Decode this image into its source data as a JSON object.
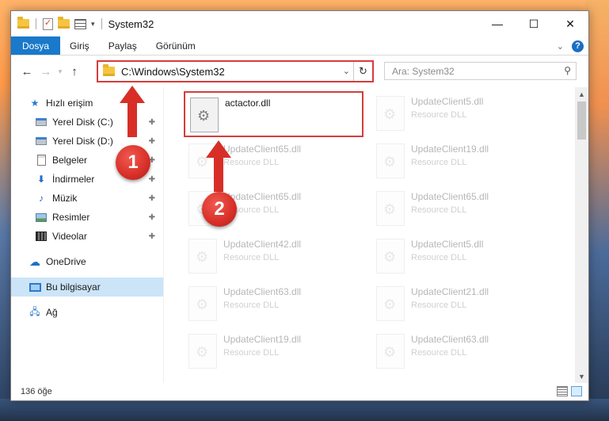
{
  "window": {
    "title": "System32",
    "qat_dropdown": "▾",
    "controls": {
      "minimize": "—",
      "maximize": "☐",
      "close": "✕"
    }
  },
  "ribbon": {
    "tabs": [
      "Dosya",
      "Giriş",
      "Paylaş",
      "Görünüm"
    ],
    "expand_chevron": "⌄",
    "help": "?"
  },
  "nav": {
    "back": "←",
    "forward": "→",
    "up": "↑",
    "address": "C:\\Windows\\System32",
    "address_dropdown": "⌄",
    "refresh": "↻",
    "search_placeholder": "Ara: System32",
    "search_icon": "⚲"
  },
  "sidebar": {
    "quick_access": "Hızlı erişim",
    "items": [
      {
        "label": "Yerel Disk (C:)",
        "icon": "disk-icon"
      },
      {
        "label": "Yerel Disk (D:)",
        "icon": "disk-icon"
      },
      {
        "label": "Belgeler",
        "icon": "document-icon"
      },
      {
        "label": "İndirmeler",
        "icon": "download-icon"
      },
      {
        "label": "Müzik",
        "icon": "music-icon"
      },
      {
        "label": "Resimler",
        "icon": "pictures-icon"
      },
      {
        "label": "Videolar",
        "icon": "video-icon"
      }
    ],
    "pin_glyph": "📌",
    "onedrive": "OneDrive",
    "this_pc": "Bu bilgisayar",
    "network": "Ağ"
  },
  "files": {
    "highlighted": {
      "name": "actactor.dll"
    },
    "left_column": [
      {
        "name": "UpdateClient65.dll",
        "type": "Resource DLL"
      },
      {
        "name": "UpdateClient65.dll",
        "type": "Resource DLL"
      },
      {
        "name": "UpdateClient42.dll",
        "type": "Resource DLL"
      },
      {
        "name": "UpdateClient63.dll",
        "type": "Resource DLL"
      },
      {
        "name": "UpdateClient19.dll",
        "type": "Resource DLL"
      }
    ],
    "right_column": [
      {
        "name": "UpdateClient5.dll",
        "type": "Resource DLL"
      },
      {
        "name": "UpdateClient19.dll",
        "type": "Resource DLL"
      },
      {
        "name": "UpdateClient65.dll",
        "type": "Resource DLL"
      },
      {
        "name": "UpdateClient5.dll",
        "type": "Resource DLL"
      },
      {
        "name": "UpdateClient21.dll",
        "type": "Resource DLL"
      },
      {
        "name": "UpdateClient63.dll",
        "type": "Resource DLL"
      }
    ],
    "gear_glyph": "⚙"
  },
  "scrollbar": {
    "up": "▲",
    "down": "▼"
  },
  "status": {
    "count": "136 öğe"
  },
  "annotations": {
    "step1": "1",
    "step2": "2"
  },
  "colors": {
    "accent": "#1979ca",
    "highlight": "#d63c3c",
    "selected": "#cce4f7"
  }
}
